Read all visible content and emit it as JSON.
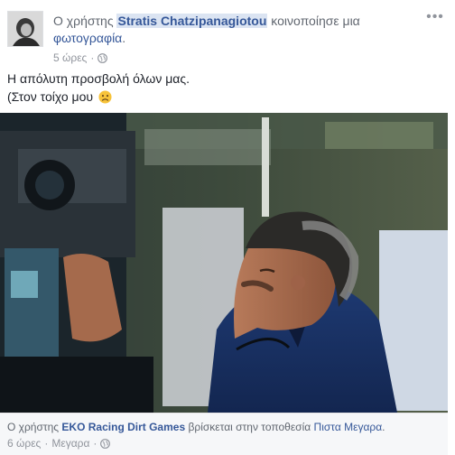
{
  "post": {
    "prefix": "Ο χρήστης",
    "author": "Stratis Chatzipanagiotou",
    "action": "κοινοποίησε μια",
    "object_link": "φωτογραφία",
    "object_suffix": ".",
    "time": "5 ώρες",
    "separator": "·",
    "privacy_icon": "globe-icon",
    "more_icon": "more-options-icon",
    "text_line1": "Η απόλυτη προσβολή όλων μας.",
    "text_line2": "(Στον τοίχο μου",
    "emoji": "disappointed-face-emoji"
  },
  "shared": {
    "prefix": "Ο χρήστης",
    "author": "EKO Racing Dirt Games",
    "action": "βρίσκεται στην τοποθεσία",
    "location": "Πιστα Μεγαρα",
    "suffix": ".",
    "time": "6 ώρες",
    "separator": "·",
    "place": "Μεγαρα",
    "privacy_icon": "globe-icon"
  },
  "colors": {
    "link": "#365899",
    "meta": "#90949c",
    "text": "#1d2129",
    "author_highlight": "#dbe4f2",
    "footer_bg": "#f6f7f9"
  }
}
